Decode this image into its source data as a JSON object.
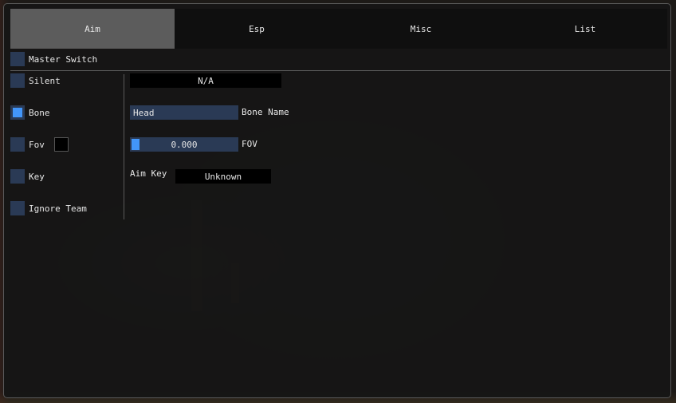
{
  "tabs": [
    {
      "label": "Aim",
      "active": true
    },
    {
      "label": "Esp",
      "active": false
    },
    {
      "label": "Misc",
      "active": false
    },
    {
      "label": "List",
      "active": false
    }
  ],
  "master_switch": {
    "label": "Master Switch",
    "checked": false
  },
  "options": {
    "silent": {
      "label": "Silent",
      "checked": false
    },
    "bone": {
      "label": "Bone",
      "checked": true
    },
    "fov": {
      "label": "Fov",
      "checked": false
    },
    "key": {
      "label": "Key",
      "checked": false
    },
    "ignore_team": {
      "label": "Ignore Team",
      "checked": false
    }
  },
  "silent_combo": {
    "value": "N/A"
  },
  "bone_name": {
    "value": "Head",
    "label": "Bone Name"
  },
  "fov_slider": {
    "value": "0.000",
    "label": "FOV"
  },
  "aim_key": {
    "label": "Aim Key",
    "value": "Unknown"
  },
  "colors": {
    "accent": "#4296fa",
    "frame_bg": "#2a3a55",
    "active_tab": "#5c5c5c",
    "window_bg": "#161616"
  }
}
